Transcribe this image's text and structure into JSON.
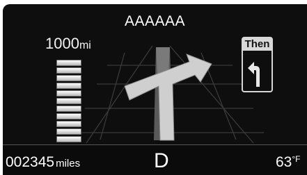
{
  "navigation": {
    "street_name": "AAAAAA",
    "distance_value": "1000",
    "distance_unit": "mi",
    "distance_meter": {
      "bars": 14,
      "filled": 14
    },
    "next_maneuver": {
      "label": "Then",
      "icon": "turn-left-arrow-icon"
    },
    "current_maneuver_icon": "turn-right-arrow-icon"
  },
  "status": {
    "odometer_value": "002345",
    "odometer_unit": "miles",
    "gear": "D",
    "temperature_value": "63",
    "temperature_unit": "°F"
  },
  "colors": {
    "screen_background": "#0e0e0e",
    "arrow_fill": "#cfcfcf",
    "text": "#ffffff"
  }
}
